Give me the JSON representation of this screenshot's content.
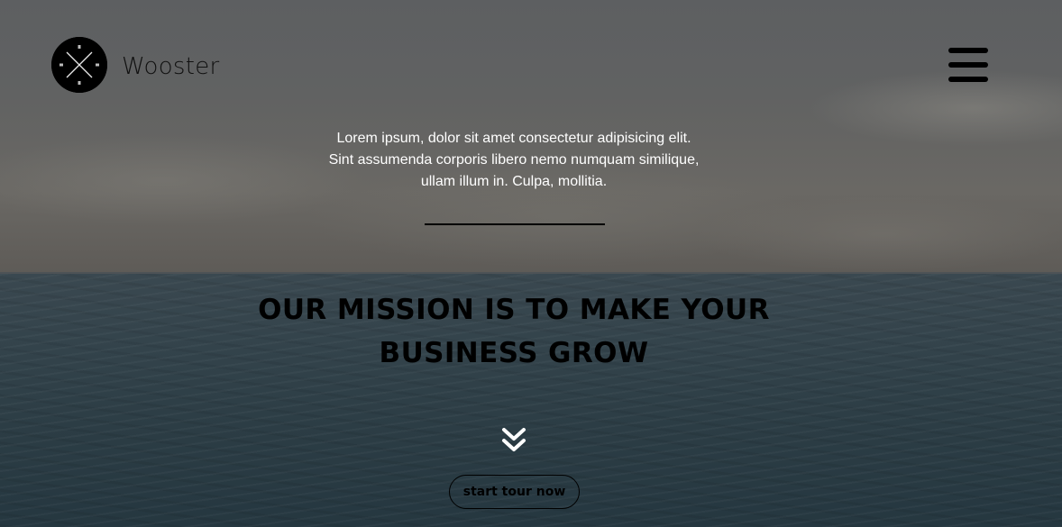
{
  "header": {
    "brand_name": "Wooster",
    "logo_icon": "x-circle-logo-icon",
    "menu_icon": "hamburger-menu-icon"
  },
  "hero": {
    "intro_text": "Lorem ipsum, dolor sit amet consectetur adipisicing elit. Sint assumenda corporis libero nemo numquam similique, ullam illum in. Culpa, mollitia.",
    "mission_heading": "OUR MISSION IS TO MAKE YOUR BUSINESS GROW",
    "scroll_icon": "double-chevron-down-icon",
    "cta_label": "start tour now"
  },
  "colors": {
    "text_dark": "#000000",
    "text_light": "#ffffff",
    "sky": "#616262",
    "sea": "#2c3d45"
  }
}
